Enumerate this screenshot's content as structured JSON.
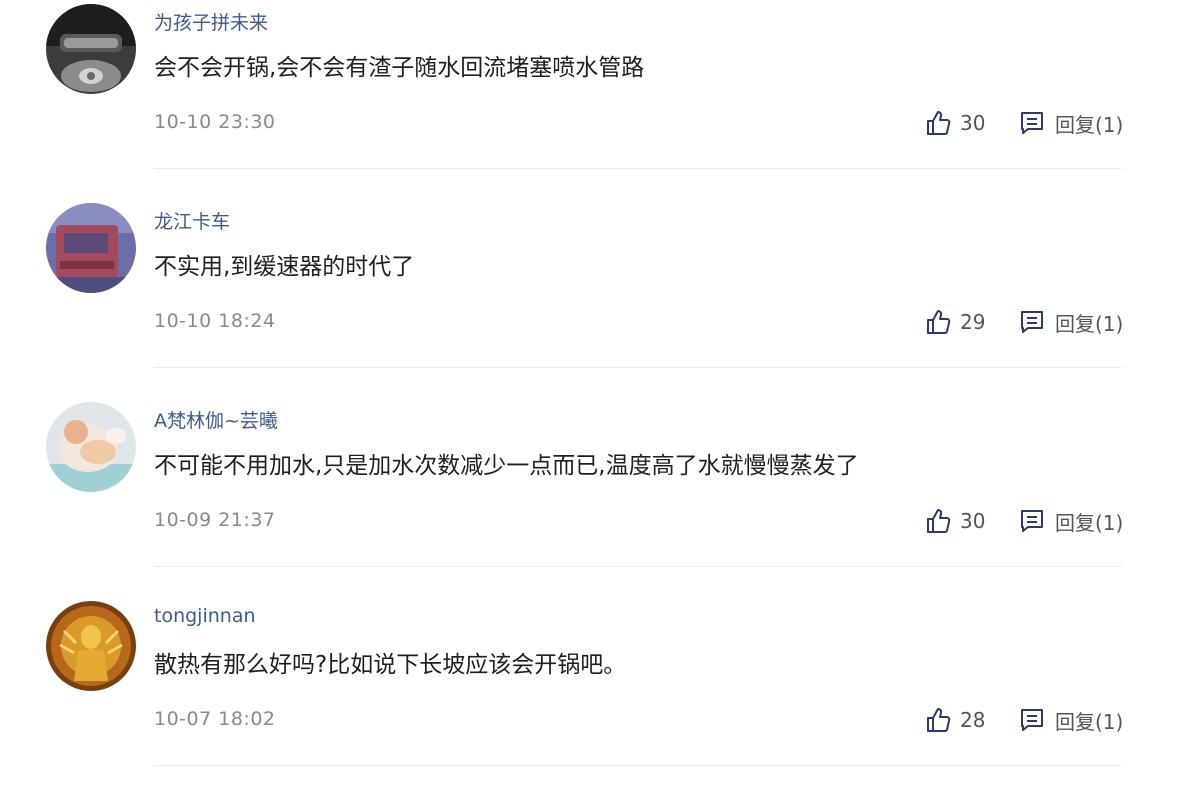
{
  "comments": [
    {
      "username": "为孩子拼未来",
      "content": "会不会开锅,会不会有渣子随水回流堵塞喷水管路",
      "timestamp": "10-10 23:30",
      "likes": "30",
      "reply_label": "回复(1)",
      "avatar_icon": "car-steering-wheel-avatar"
    },
    {
      "username": "龙江卡车",
      "content": "不实用,到缓速器的时代了",
      "timestamp": "10-10 18:24",
      "likes": "29",
      "reply_label": "回复(1)",
      "avatar_icon": "red-truck-avatar"
    },
    {
      "username": "A梵林伽~芸曦",
      "content": "不可能不用加水,只是加水次数减少一点而已,温度高了水就慢慢蒸发了",
      "timestamp": "10-09 21:37",
      "likes": "30",
      "reply_label": "回复(1)",
      "avatar_icon": "baby-photo-avatar"
    },
    {
      "username": "tongjinnan",
      "content": "散热有那么好吗?比如说下长坡应该会开锅吧。",
      "timestamp": "10-07 18:02",
      "likes": "28",
      "reply_label": "回复(1)",
      "avatar_icon": "golden-buddha-avatar"
    }
  ],
  "colors": {
    "username": "#3d5a94",
    "content": "#1f1f1f",
    "meta": "#8a8a8a",
    "action": "#555555",
    "divider": "#ececec"
  }
}
